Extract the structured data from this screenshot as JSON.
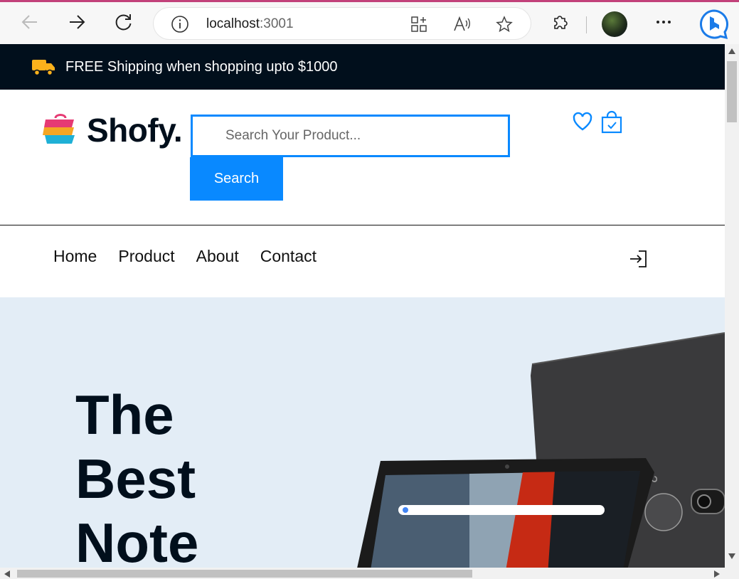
{
  "browser": {
    "url_host": "localhost",
    "url_port": ":3001"
  },
  "topbar": {
    "message": "FREE Shipping when shopping upto $1000"
  },
  "header": {
    "logo_text": "Shofy.",
    "search_placeholder": "Search Your Product...",
    "search_button": "Search"
  },
  "nav": {
    "items": [
      "Home",
      "Product",
      "About",
      "Contact"
    ]
  },
  "hero": {
    "lines": [
      "The",
      "Best",
      "Note"
    ]
  },
  "colors": {
    "accent": "#0989ff",
    "dark": "#010f1c",
    "hero_bg": "#e3edf6",
    "truck": "#fbb11c"
  }
}
